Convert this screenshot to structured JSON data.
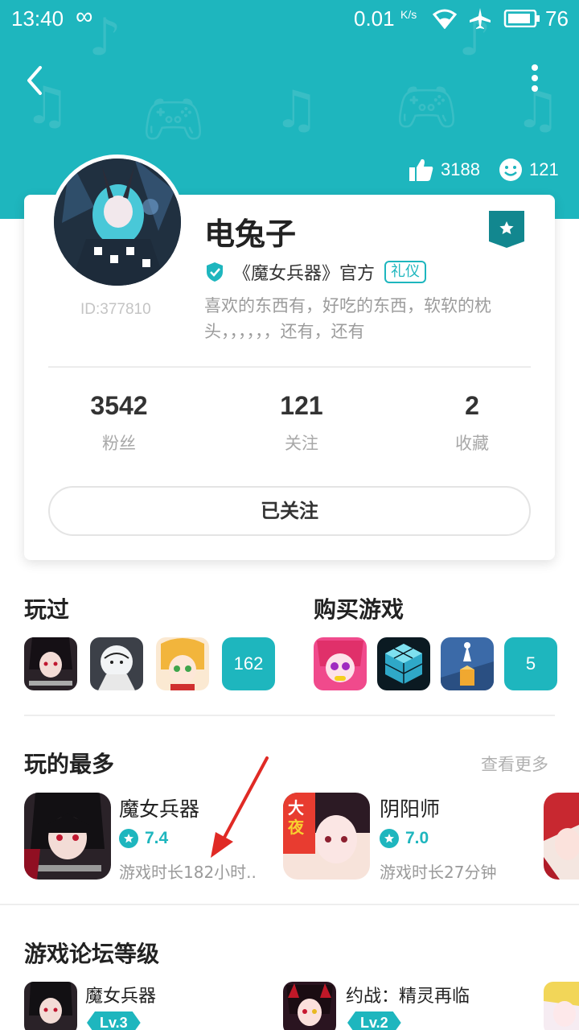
{
  "status_bar": {
    "time": "13:40",
    "loop_icon": "infinity-icon",
    "net_speed": "0.01",
    "net_unit": "K/s",
    "battery": "76"
  },
  "header": {
    "back_icon": "back-arrow-icon",
    "more_icon": "more-vertical-icon",
    "likes": "3188",
    "smiles": "121",
    "bg_color": "#1eb6be"
  },
  "profile": {
    "name": "电兔子",
    "uid": "ID:377810",
    "official_label": "《魔女兵器》官方",
    "tag": "礼仪",
    "bio": "喜欢的东西有，好吃的东西，软软的枕头，，，，，，还有，还有",
    "stats": [
      {
        "value": "3542",
        "label": "粉丝"
      },
      {
        "value": "121",
        "label": "关注"
      },
      {
        "value": "2",
        "label": "收藏"
      }
    ],
    "follow_button": "已关注"
  },
  "played": {
    "title": "玩过",
    "count": "162"
  },
  "purchased": {
    "title": "购买游戏",
    "count": "5"
  },
  "most_played": {
    "title": "玩的最多",
    "see_more": "查看更多",
    "games": [
      {
        "name": "魔女兵器",
        "rating": "7.4",
        "time": "游戏时长182小时.."
      },
      {
        "name": "阴阳师",
        "rating": "7.0",
        "time": "游戏时长27分钟"
      }
    ]
  },
  "forum": {
    "title": "游戏论坛等级",
    "games": [
      {
        "name": "魔女兵器",
        "level": "Lv.3"
      },
      {
        "name": "约战：精灵再临",
        "level": "Lv.2"
      }
    ]
  }
}
